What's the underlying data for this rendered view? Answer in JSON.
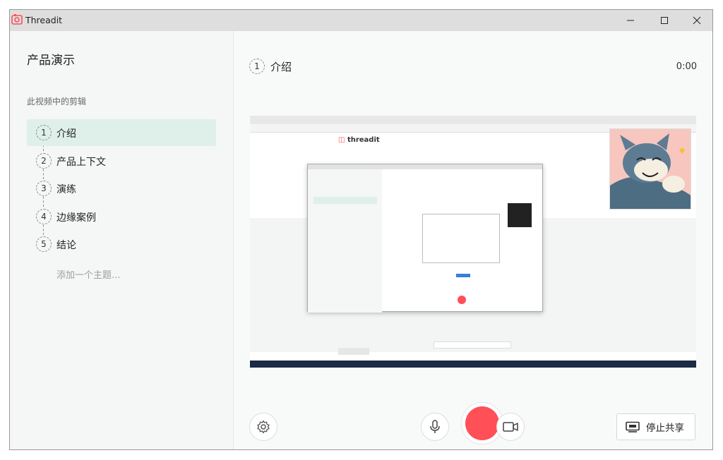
{
  "window": {
    "title": "Threadit",
    "controls": [
      "minimize",
      "maximize",
      "close"
    ]
  },
  "sidebar": {
    "title": "产品演示",
    "subtitle": "此视频中的剪辑",
    "topics": [
      {
        "num": "1",
        "label": "介绍",
        "active": true
      },
      {
        "num": "2",
        "label": "产品上下文",
        "active": false
      },
      {
        "num": "3",
        "label": "演练",
        "active": false
      },
      {
        "num": "4",
        "label": "边缘案例",
        "active": false
      },
      {
        "num": "5",
        "label": "结论",
        "active": false
      }
    ],
    "add_topic": "添加一个主题..."
  },
  "main": {
    "current_num": "1",
    "current_title": "介绍",
    "timer": "0:00",
    "preview_logo": "threadit"
  },
  "controls": {
    "settings_icon": "gear-icon",
    "mic_icon": "microphone-icon",
    "record_icon": "record-icon",
    "camera_icon": "camera-icon",
    "stop_share_label": "停止共享",
    "stop_share_icon": "screen-share-icon"
  },
  "colors": {
    "accent": "#ff4f57",
    "active_topic_bg": "#dff0eb",
    "titlebar_bg": "#dedede"
  }
}
